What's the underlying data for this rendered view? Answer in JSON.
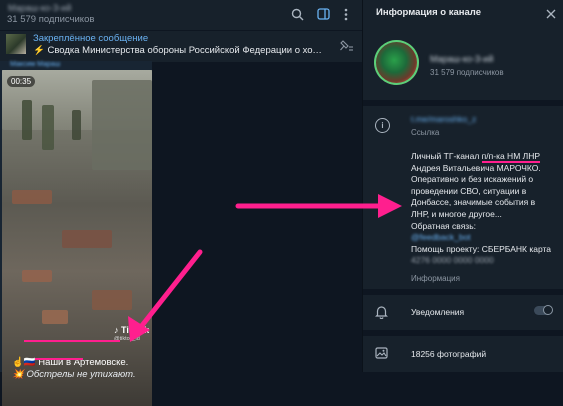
{
  "header": {
    "channel_name": "Мараш-ко-З-ий",
    "subscribers": "31 579 подписчиков"
  },
  "pinned": {
    "label": "Закреплённое сообщение",
    "text": "⚡ Сводка Министерства обороны Российской Федерации о ходе п..."
  },
  "message": {
    "forward_from": "Максим Мараш",
    "timecode": "00:35",
    "tiktok_brand": "♪ TikTok",
    "tiktok_handle": "@tiktok_id",
    "caption_line1": "☝️🇷🇺 Наши в Артемовске.",
    "caption_line2": "💥 Обстрелы не утихают."
  },
  "info_panel": {
    "title": "Информация о канале",
    "channel_name": "Мараш-ко-З-ий",
    "subscribers": "31 579 подписчиков",
    "link_text": "t.me/maroshko_z",
    "link_label": "Ссылка",
    "description_lines": [
      "Личный ТГ-канал п/п-ка НМ ЛНР",
      "Андрея Витальевича МАРОЧКО.",
      "Оперативно и без искажений о",
      "проведении СВО, ситуации в",
      "Донбассе, значимые события в",
      "ЛНР, и многое другое...",
      "Обратная связь:"
    ],
    "contact_blur": "@feedback_bot",
    "support_line": "Помощь проекту: СБЕРБАНК карта",
    "card_blur": "4276 0000 0000 0000",
    "description_label": "Информация",
    "notifications_label": "Уведомления",
    "notifications_on": false,
    "photos_count": "18256 фотографий"
  },
  "colors": {
    "background": "#0e1621",
    "panel": "#17212b",
    "accent": "#6ab2f2",
    "annotation": "#ff1f8e"
  }
}
